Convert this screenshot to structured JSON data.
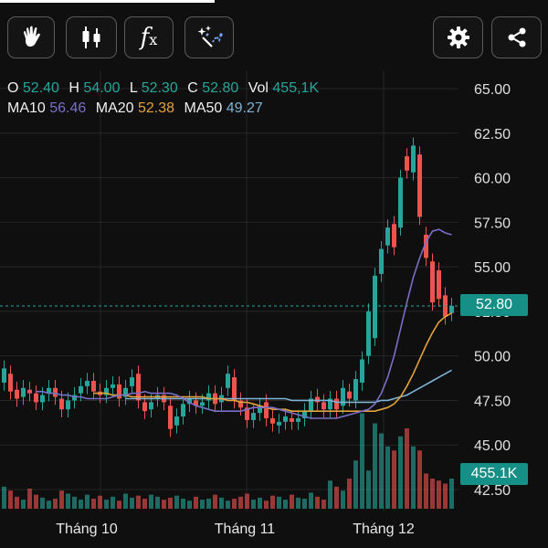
{
  "toolbar": {
    "buttons": [
      {
        "name": "hand-pointer-button",
        "icon": "hand-icon"
      },
      {
        "name": "candlestick-type-button",
        "icon": "candlestick-icon"
      },
      {
        "name": "indicator-button",
        "icon": "fx-icon"
      },
      {
        "name": "drawing-tools-button",
        "icon": "magic-wand-icon"
      },
      {
        "name": "settings-button",
        "icon": "gear-icon"
      },
      {
        "name": "share-button",
        "icon": "share-icon"
      }
    ],
    "fx_label": "f",
    "fx_sub": "x"
  },
  "ohlc": {
    "o_label": "O",
    "o_value": "52.40",
    "h_label": "H",
    "h_value": "54.00",
    "l_label": "L",
    "l_value": "52.30",
    "c_label": "C",
    "c_value": "52.80",
    "vol_label": "Vol",
    "vol_value": "455,1K"
  },
  "ma": {
    "ma10_label": "MA10",
    "ma10_value": "56.46",
    "ma20_label": "MA20",
    "ma20_value": "52.38",
    "ma50_label": "MA50",
    "ma50_value": "49.27"
  },
  "current_price_label": "52.80",
  "current_volume_label": "455.1K",
  "colors": {
    "up": "#26a69a",
    "down": "#ef5350",
    "ma10": "#7a6fc8",
    "ma20": "#e2a33a",
    "ma50": "#7fb3d5",
    "badge": "#168f86"
  },
  "chart_data": {
    "type": "candlestick",
    "ylim": [
      41.5,
      66.5
    ],
    "y_ticks": [
      "65.00",
      "62.50",
      "60.00",
      "57.50",
      "55.00",
      "52.50",
      "50.00",
      "47.50",
      "45.00",
      "42.50"
    ],
    "x_labels": [
      "Tháng 10",
      "Tháng 11",
      "Tháng 12"
    ],
    "current_price": 52.8,
    "candles": [
      {
        "o": 48.5,
        "c": 49.3
      },
      {
        "o": 49.0,
        "c": 48.0
      },
      {
        "o": 48.1,
        "c": 47.6
      },
      {
        "o": 47.7,
        "c": 48.2
      },
      {
        "o": 48.1,
        "c": 47.9
      },
      {
        "o": 47.9,
        "c": 47.4
      },
      {
        "o": 47.4,
        "c": 47.8
      },
      {
        "o": 47.9,
        "c": 48.2
      },
      {
        "o": 48.2,
        "c": 47.7
      },
      {
        "o": 47.6,
        "c": 47.0
      },
      {
        "o": 47.0,
        "c": 47.5
      },
      {
        "o": 47.5,
        "c": 47.8
      },
      {
        "o": 47.9,
        "c": 48.3
      },
      {
        "o": 48.3,
        "c": 48.6
      },
      {
        "o": 48.6,
        "c": 48.0
      },
      {
        "o": 48.0,
        "c": 47.8
      },
      {
        "o": 47.8,
        "c": 48.2
      },
      {
        "o": 48.2,
        "c": 48.4
      },
      {
        "o": 48.4,
        "c": 47.6
      },
      {
        "o": 47.7,
        "c": 48.2
      },
      {
        "o": 48.3,
        "c": 48.8
      },
      {
        "o": 49.0,
        "c": 47.5
      },
      {
        "o": 47.4,
        "c": 46.9
      },
      {
        "o": 47.0,
        "c": 47.4
      },
      {
        "o": 47.6,
        "c": 47.8
      },
      {
        "o": 47.8,
        "c": 47.4
      },
      {
        "o": 47.2,
        "c": 45.9
      },
      {
        "o": 46.1,
        "c": 46.6
      },
      {
        "o": 46.6,
        "c": 47.3
      },
      {
        "o": 47.3,
        "c": 47.6
      },
      {
        "o": 47.5,
        "c": 47.2
      },
      {
        "o": 47.2,
        "c": 47.4
      },
      {
        "o": 47.5,
        "c": 47.9
      },
      {
        "o": 47.9,
        "c": 47.3
      },
      {
        "o": 47.4,
        "c": 47.8
      },
      {
        "o": 48.2,
        "c": 49.0
      },
      {
        "o": 48.8,
        "c": 47.5
      },
      {
        "o": 47.5,
        "c": 47.1
      },
      {
        "o": 47.1,
        "c": 46.4
      },
      {
        "o": 46.4,
        "c": 46.8
      },
      {
        "o": 46.8,
        "c": 47.2
      },
      {
        "o": 47.4,
        "c": 46.5
      },
      {
        "o": 46.5,
        "c": 46.2
      },
      {
        "o": 46.1,
        "c": 46.3
      },
      {
        "o": 46.3,
        "c": 46.6
      },
      {
        "o": 46.5,
        "c": 46.3
      },
      {
        "o": 46.3,
        "c": 46.5
      },
      {
        "o": 46.5,
        "c": 46.9
      },
      {
        "o": 46.9,
        "c": 47.6
      },
      {
        "o": 47.7,
        "c": 47.4
      },
      {
        "o": 47.4,
        "c": 47.0
      },
      {
        "o": 47.0,
        "c": 47.6
      },
      {
        "o": 47.6,
        "c": 47.0
      },
      {
        "o": 47.2,
        "c": 48.2
      },
      {
        "o": 48.0,
        "c": 47.6
      },
      {
        "o": 47.5,
        "c": 48.7
      },
      {
        "o": 48.5,
        "c": 49.8
      },
      {
        "o": 50.0,
        "c": 52.5
      },
      {
        "o": 51.0,
        "c": 54.5
      },
      {
        "o": 54.6,
        "c": 56.0
      },
      {
        "o": 56.2,
        "c": 57.2
      },
      {
        "o": 57.4,
        "c": 56.1
      },
      {
        "o": 57.2,
        "c": 60.0
      },
      {
        "o": 61.2,
        "c": 60.4
      },
      {
        "o": 60.3,
        "c": 61.8
      },
      {
        "o": 61.3,
        "c": 57.8
      },
      {
        "o": 56.8,
        "c": 55.5
      },
      {
        "o": 55.3,
        "c": 53.0
      },
      {
        "o": 54.8,
        "c": 53.2
      },
      {
        "o": 53.4,
        "c": 52.2
      },
      {
        "o": 52.4,
        "c": 52.8
      }
    ],
    "volumes": [
      0.22,
      0.18,
      0.12,
      0.09,
      0.2,
      0.14,
      0.11,
      0.08,
      0.1,
      0.18,
      0.15,
      0.12,
      0.09,
      0.14,
      0.1,
      0.13,
      0.09,
      0.12,
      0.08,
      0.15,
      0.11,
      0.13,
      0.1,
      0.14,
      0.12,
      0.09,
      0.11,
      0.13,
      0.1,
      0.08,
      0.12,
      0.09,
      0.1,
      0.14,
      0.11,
      0.08,
      0.1,
      0.12,
      0.15,
      0.09,
      0.11,
      0.08,
      0.13,
      0.12,
      0.09,
      0.14,
      0.11,
      0.1,
      0.16,
      0.12,
      0.09,
      0.28,
      0.22,
      0.18,
      0.3,
      0.48,
      0.95,
      0.38,
      0.85,
      0.75,
      0.62,
      0.58,
      0.72,
      0.8,
      0.62,
      0.58,
      0.35,
      0.3,
      0.28,
      0.25,
      0.3
    ],
    "ma10": [
      48.0,
      48.0,
      47.9,
      47.9,
      47.8,
      47.8,
      47.7,
      47.7,
      47.6,
      47.6,
      47.6,
      47.6,
      47.7,
      47.8,
      47.8,
      47.9,
      47.9,
      48.0,
      47.9,
      47.9,
      47.9,
      47.9,
      47.8,
      47.6,
      47.4,
      47.2,
      47.1,
      47.0,
      46.9,
      46.9,
      46.9,
      46.9,
      46.9,
      47.0,
      47.1,
      47.1,
      47.1,
      47.1,
      47.0,
      46.9,
      46.8,
      46.7,
      46.6,
      46.5,
      46.5,
      46.5,
      46.5,
      46.5,
      46.6,
      46.7,
      46.8,
      46.9,
      47.0,
      47.3,
      47.9,
      48.8,
      50.0,
      51.5,
      53.0,
      54.4,
      55.5,
      56.4,
      57.0,
      57.1,
      56.9,
      56.8
    ],
    "ma20": [
      47.9,
      47.9,
      47.9,
      47.8,
      47.8,
      47.8,
      47.7,
      47.7,
      47.7,
      47.7,
      47.7,
      47.7,
      47.7,
      47.7,
      47.7,
      47.7,
      47.7,
      47.7,
      47.6,
      47.6,
      47.6,
      47.5,
      47.5,
      47.4,
      47.4,
      47.3,
      47.2,
      47.1,
      47.0,
      47.0,
      47.0,
      46.9,
      46.9,
      46.9,
      46.9,
      46.9,
      46.9,
      46.9,
      46.9,
      46.9,
      46.9,
      46.9,
      46.9,
      46.9,
      46.9,
      47.0,
      47.1,
      47.3,
      47.7,
      48.3,
      49.0,
      49.8,
      50.6,
      51.3,
      51.9,
      52.2,
      52.4
    ],
    "ma50": [
      47.6,
      47.6,
      47.6,
      47.6,
      47.6,
      47.6,
      47.6,
      47.6,
      47.6,
      47.6,
      47.6,
      47.6,
      47.6,
      47.6,
      47.6,
      47.6,
      47.6,
      47.6,
      47.6,
      47.6,
      47.6,
      47.6,
      47.6,
      47.6,
      47.6,
      47.6,
      47.5,
      47.5,
      47.5,
      47.5,
      47.5,
      47.5,
      47.5,
      47.4,
      47.4,
      47.4,
      47.4,
      47.4,
      47.4,
      47.4,
      47.5,
      47.5,
      47.6,
      47.7,
      47.8,
      48.0,
      48.2,
      48.4,
      48.6,
      48.8,
      49.0,
      49.2
    ]
  }
}
